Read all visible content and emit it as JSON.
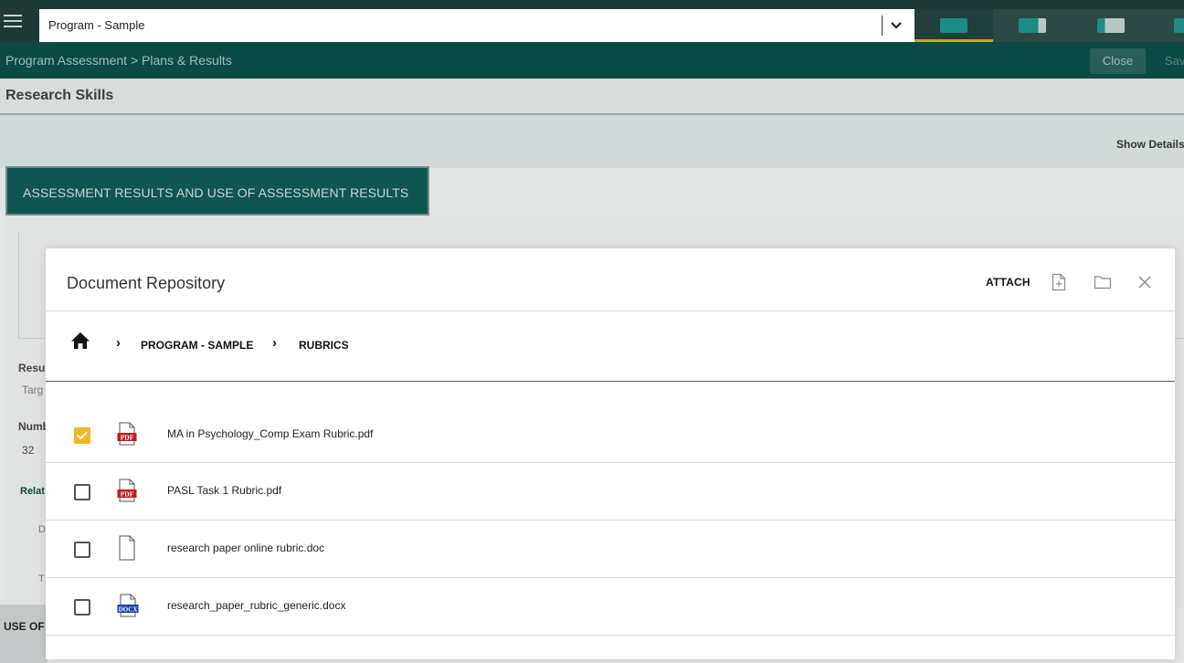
{
  "app": {
    "program_select": {
      "value": "Program - Sample"
    },
    "breadcrumb": "Program Assessment > Plans & Results",
    "close_label": "Close",
    "save_label": "Save",
    "page_title": "Research Skills",
    "show_details_label": "Show Details",
    "section_tab": "ASSESSMENT RESULTS AND USE OF ASSESSMENT RESULTS",
    "side_labels": [
      "Resul",
      "Targ",
      "Numb",
      "32",
      "Relat",
      "D",
      "T"
    ],
    "bottom_label": "USE OF"
  },
  "modal": {
    "title": "Document Repository",
    "attach_label": "ATTACH",
    "icons": {
      "new": "new-file-icon",
      "folder": "folder-icon",
      "close": "close-icon",
      "home": "home-icon"
    },
    "breadcrumb": [
      "PROGRAM - SAMPLE",
      "RUBRICS"
    ],
    "files": [
      {
        "name": "MA in Psychology_Comp Exam Rubric.pdf",
        "type": "pdf",
        "checked": true
      },
      {
        "name": "PASL Task 1 Rubric.pdf",
        "type": "pdf",
        "checked": false
      },
      {
        "name": "research paper online rubric.doc",
        "type": "blank",
        "checked": false
      },
      {
        "name": "research_paper_rubric_generic.docx",
        "type": "docx",
        "checked": false
      }
    ]
  },
  "colors": {
    "topbar": "#1f3a36",
    "accent_green": "#0c4a45",
    "checkbox_checked": "#f4b622",
    "pdf_red": "#c21a1a",
    "docx_blue": "#1e3fa6"
  }
}
